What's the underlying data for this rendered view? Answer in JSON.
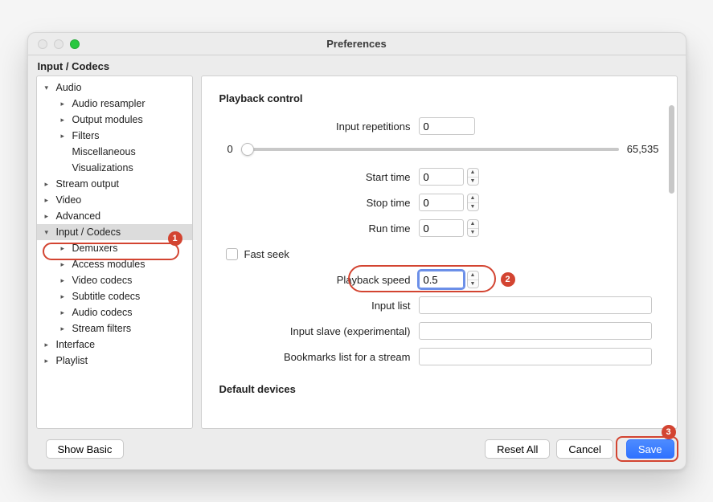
{
  "window": {
    "title": "Preferences"
  },
  "section_header": "Input / Codecs",
  "sidebar": {
    "items": [
      {
        "label": "Audio",
        "depth": 1,
        "expanded": true,
        "selected": false
      },
      {
        "label": "Audio resampler",
        "depth": 2,
        "expanded": false,
        "selected": false
      },
      {
        "label": "Output modules",
        "depth": 2,
        "expanded": false,
        "selected": false
      },
      {
        "label": "Filters",
        "depth": 2,
        "expanded": false,
        "selected": false
      },
      {
        "label": "Miscellaneous",
        "depth": 2,
        "expanded": null,
        "selected": false
      },
      {
        "label": "Visualizations",
        "depth": 2,
        "expanded": null,
        "selected": false
      },
      {
        "label": "Stream output",
        "depth": 1,
        "expanded": false,
        "selected": false
      },
      {
        "label": "Video",
        "depth": 1,
        "expanded": false,
        "selected": false
      },
      {
        "label": "Advanced",
        "depth": 1,
        "expanded": false,
        "selected": false
      },
      {
        "label": "Input / Codecs",
        "depth": 1,
        "expanded": true,
        "selected": true
      },
      {
        "label": "Demuxers",
        "depth": 2,
        "expanded": false,
        "selected": false
      },
      {
        "label": "Access modules",
        "depth": 2,
        "expanded": false,
        "selected": false
      },
      {
        "label": "Video codecs",
        "depth": 2,
        "expanded": false,
        "selected": false
      },
      {
        "label": "Subtitle codecs",
        "depth": 2,
        "expanded": false,
        "selected": false
      },
      {
        "label": "Audio codecs",
        "depth": 2,
        "expanded": false,
        "selected": false
      },
      {
        "label": "Stream filters",
        "depth": 2,
        "expanded": false,
        "selected": false
      },
      {
        "label": "Interface",
        "depth": 1,
        "expanded": false,
        "selected": false
      },
      {
        "label": "Playlist",
        "depth": 1,
        "expanded": false,
        "selected": false
      }
    ]
  },
  "playback": {
    "group_title": "Playback control",
    "input_repetitions_label": "Input repetitions",
    "input_repetitions_value": "0",
    "slider_min": "0",
    "slider_max": "65,535",
    "start_time_label": "Start time",
    "start_time_value": "0",
    "stop_time_label": "Stop time",
    "stop_time_value": "0",
    "run_time_label": "Run time",
    "run_time_value": "0",
    "fast_seek_label": "Fast seek",
    "fast_seek_checked": false,
    "playback_speed_label": "Playback speed",
    "playback_speed_value": "0.5",
    "input_list_label": "Input list",
    "input_list_value": "",
    "input_slave_label": "Input slave (experimental)",
    "input_slave_value": "",
    "bookmarks_label": "Bookmarks list for a stream",
    "bookmarks_value": ""
  },
  "default_devices": {
    "group_title": "Default devices"
  },
  "footer": {
    "show_basic": "Show Basic",
    "reset_all": "Reset All",
    "cancel": "Cancel",
    "save": "Save"
  },
  "annotations": {
    "b1": "1",
    "b2": "2",
    "b3": "3"
  }
}
